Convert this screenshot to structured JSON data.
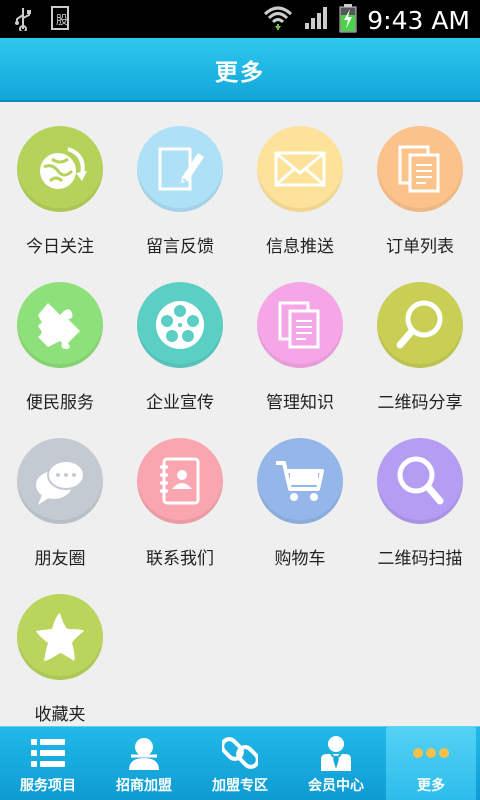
{
  "status_bar": {
    "time": "9:43 AM"
  },
  "header": {
    "title": "更多"
  },
  "colors": {
    "accent": "#15a9dc",
    "circles": [
      "#b5d35a",
      "#aee0f6",
      "#fde39a",
      "#fbc38a",
      "#8ee07a",
      "#5ccfc5",
      "#f5a6e6",
      "#c8cf54",
      "#c3cad2",
      "#f9a6b0",
      "#94b6e8",
      "#b49df2",
      "#b9d55c"
    ]
  },
  "grid": {
    "items": [
      {
        "label": "今日关注",
        "icon": "globe-arrow-icon"
      },
      {
        "label": "留言反馈",
        "icon": "edit-note-icon"
      },
      {
        "label": "信息推送",
        "icon": "envelope-icon"
      },
      {
        "label": "订单列表",
        "icon": "documents-icon"
      },
      {
        "label": "便民服务",
        "icon": "puzzle-icon"
      },
      {
        "label": "企业宣传",
        "icon": "film-reel-icon"
      },
      {
        "label": "管理知识",
        "icon": "documents-icon"
      },
      {
        "label": "二维码分享",
        "icon": "magnifier-icon"
      },
      {
        "label": "朋友圈",
        "icon": "chat-bubbles-icon"
      },
      {
        "label": "联系我们",
        "icon": "contact-book-icon"
      },
      {
        "label": "购物车",
        "icon": "shopping-cart-icon"
      },
      {
        "label": "二维码扫描",
        "icon": "magnifier-icon"
      },
      {
        "label": "收藏夹",
        "icon": "star-icon"
      }
    ]
  },
  "tabbar": {
    "tabs": [
      {
        "label": "服务项目",
        "icon": "list-icon"
      },
      {
        "label": "招商加盟",
        "icon": "person-icon"
      },
      {
        "label": "加盟专区",
        "icon": "chain-link-icon"
      },
      {
        "label": "会员中心",
        "icon": "member-icon"
      },
      {
        "label": "更多",
        "icon": "dots-icon",
        "active": true
      }
    ]
  }
}
